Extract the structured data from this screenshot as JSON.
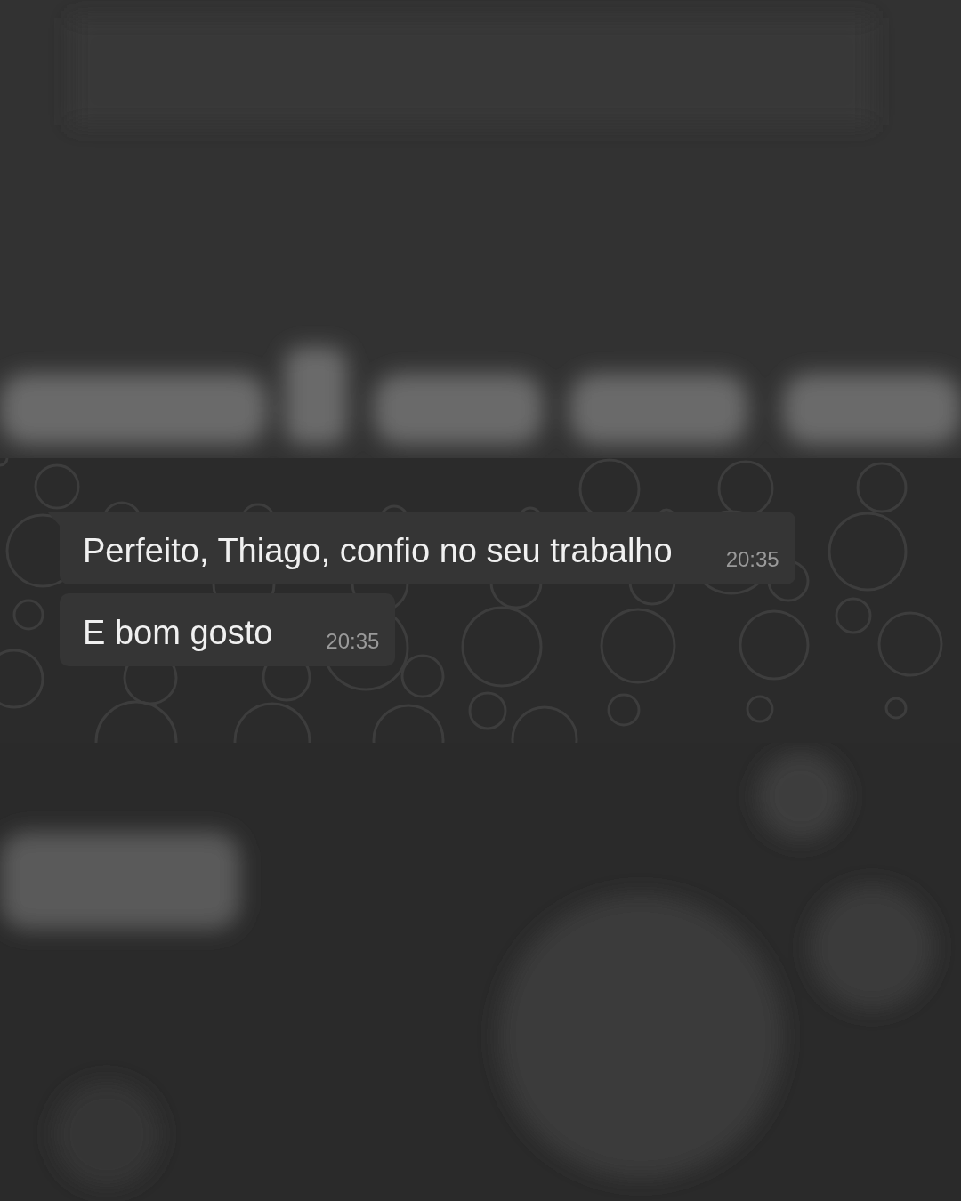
{
  "chat": {
    "messages": [
      {
        "text": "Perfeito, Thiago, confio no seu trabalho",
        "time": "20:35",
        "tail": true
      },
      {
        "text": "E bom gosto",
        "time": "20:35",
        "tail": false
      }
    ]
  }
}
